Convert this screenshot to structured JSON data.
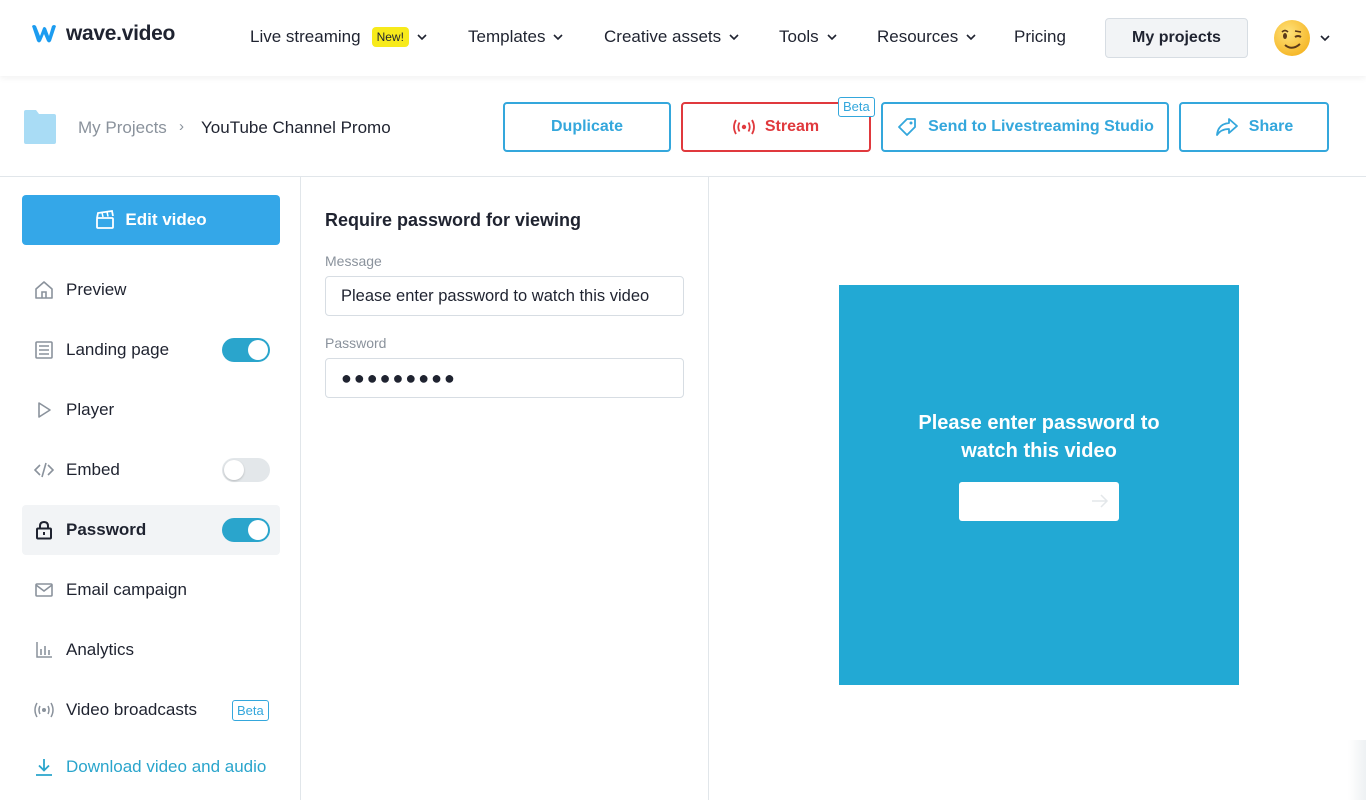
{
  "app": {
    "logo_text": "wave.video",
    "brand_color": "#1c9cf0"
  },
  "nav": {
    "items": [
      {
        "label": "Live streaming",
        "badge": "New!"
      },
      {
        "label": "Templates"
      },
      {
        "label": "Creative assets"
      },
      {
        "label": "Tools"
      },
      {
        "label": "Resources"
      },
      {
        "label": "Pricing"
      }
    ],
    "my_projects_label": "My projects",
    "avatar_icon": "winking-face-emoji"
  },
  "breadcrumb": {
    "root": "My Projects",
    "separator": "›",
    "current": "YouTube Channel Promo"
  },
  "actions": {
    "duplicate": "Duplicate",
    "stream": "Stream",
    "stream_badge": "Beta",
    "send_studio": "Send to Livestreaming Studio",
    "share": "Share"
  },
  "sidebar": {
    "edit_video": "Edit video",
    "items": [
      {
        "label": "Preview",
        "icon": "home-icon"
      },
      {
        "label": "Landing page",
        "icon": "page-icon",
        "toggle": true
      },
      {
        "label": "Player",
        "icon": "play-icon"
      },
      {
        "label": "Embed",
        "icon": "code-icon",
        "toggle": false
      },
      {
        "label": "Password",
        "icon": "lock-icon",
        "toggle": true,
        "active": true
      },
      {
        "label": "Email campaign",
        "icon": "mail-icon"
      },
      {
        "label": "Analytics",
        "icon": "bar-chart-icon"
      },
      {
        "label": "Video broadcasts",
        "icon": "broadcast-icon",
        "badge": "Beta"
      }
    ],
    "download": "Download video and audio"
  },
  "form": {
    "title": "Require password for viewing",
    "message_label": "Message",
    "message_value": "Please enter password to watch this video",
    "password_label": "Password",
    "password_value": "●●●●●●●●●"
  },
  "preview": {
    "message": "Please enter password to watch this video",
    "bg_color": "#22a9d4"
  },
  "colors": {
    "accent": "#34a7dc",
    "stream_red": "#e0393d",
    "toggle_on": "#2aa5cc"
  }
}
